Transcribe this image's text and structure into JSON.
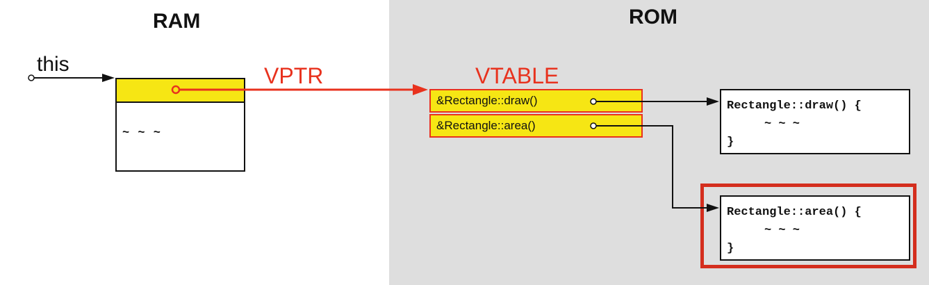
{
  "diagram": {
    "ram_title": "RAM",
    "rom_title": "ROM",
    "this_label": "this",
    "vptr_label": "VPTR",
    "vtable_label": "VTABLE",
    "ram_object_body": "~ ~ ~",
    "vtable_entries": [
      "&Rectangle::draw()",
      "&Rectangle::area()"
    ],
    "functions": [
      {
        "signature": "Rectangle::draw() {",
        "body": "~ ~ ~",
        "close": "}"
      },
      {
        "signature": "Rectangle::area() {",
        "body": "~ ~ ~",
        "close": "}"
      }
    ],
    "colors": {
      "rom_background": "#dedede",
      "slot_fill": "#f6e614",
      "accent_red": "#e8321e",
      "outline": "#111111"
    }
  }
}
